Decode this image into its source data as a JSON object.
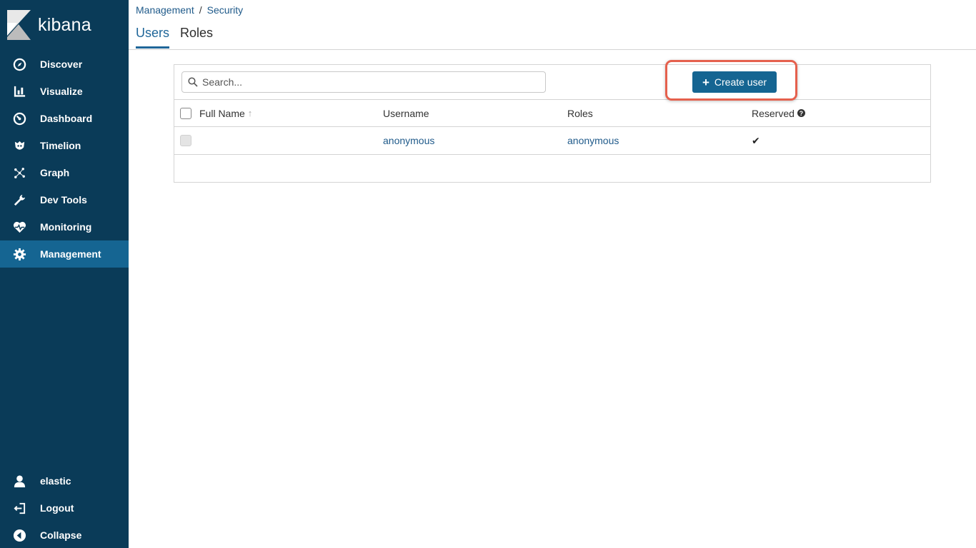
{
  "app": {
    "logo_text": "kibana"
  },
  "sidebar": {
    "items": [
      {
        "label": "Discover",
        "icon": "compass-icon"
      },
      {
        "label": "Visualize",
        "icon": "bar-chart-icon"
      },
      {
        "label": "Dashboard",
        "icon": "dashboard-icon"
      },
      {
        "label": "Timelion",
        "icon": "timelion-icon"
      },
      {
        "label": "Graph",
        "icon": "graph-icon"
      },
      {
        "label": "Dev Tools",
        "icon": "wrench-icon"
      },
      {
        "label": "Monitoring",
        "icon": "heartbeat-icon"
      },
      {
        "label": "Management",
        "icon": "gear-icon",
        "active": true
      }
    ],
    "bottom_items": [
      {
        "label": "elastic",
        "icon": "user-icon"
      },
      {
        "label": "Logout",
        "icon": "logout-icon"
      },
      {
        "label": "Collapse",
        "icon": "collapse-icon"
      }
    ]
  },
  "breadcrumb": {
    "items": [
      "Management",
      "Security"
    ],
    "separator": "/"
  },
  "tabs": [
    {
      "label": "Users",
      "active": true
    },
    {
      "label": "Roles",
      "active": false
    }
  ],
  "search": {
    "placeholder": "Search...",
    "value": ""
  },
  "create_button": {
    "label": "Create user"
  },
  "table": {
    "headers": {
      "full_name": "Full Name",
      "username": "Username",
      "roles": "Roles",
      "reserved": "Reserved"
    },
    "rows": [
      {
        "full_name": "",
        "username": "anonymous",
        "roles": "anonymous",
        "reserved": "✔"
      }
    ]
  },
  "colors": {
    "sidebar_bg": "#0a3b58",
    "active_bg": "#156592",
    "link": "#1f5a8a",
    "highlight": "#e5604d"
  }
}
